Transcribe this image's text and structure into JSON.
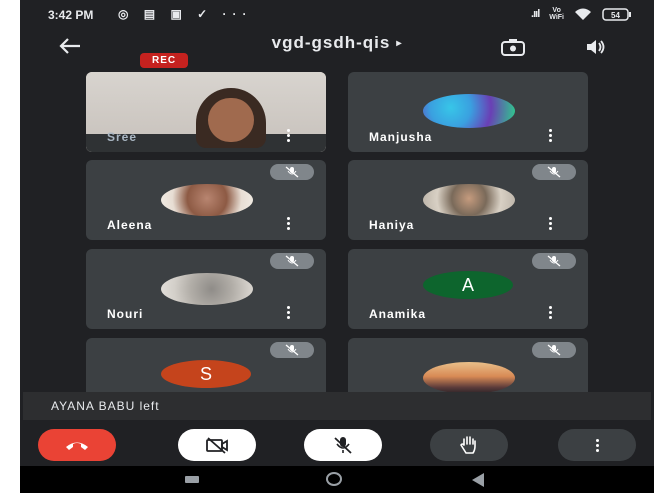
{
  "status_bar": {
    "time": "3:42 PM",
    "left_icons": "◎ ▤ ▣ ✓ ···",
    "signal": ".ııl",
    "vowifi": "Vo\nWiFi",
    "battery": "54"
  },
  "header": {
    "meeting_code": "vgd-gsdh-qis",
    "arrow": "▸",
    "rec_label": "REC"
  },
  "participants": [
    {
      "name": "Sree",
      "muted": false,
      "kind": "video"
    },
    {
      "name": "Manjusha",
      "muted": false,
      "kind": "photo"
    },
    {
      "name": "Aleena",
      "muted": true,
      "kind": "photo"
    },
    {
      "name": "Haniya",
      "muted": true,
      "kind": "photo"
    },
    {
      "name": "Nouri",
      "muted": true,
      "kind": "photo"
    },
    {
      "name": "Anamika",
      "muted": true,
      "kind": "letter",
      "letter": "A",
      "color": "#0d652d"
    },
    {
      "name": "",
      "muted": true,
      "kind": "letter",
      "letter": "S",
      "color": "#c5441c"
    },
    {
      "name": "",
      "muted": true,
      "kind": "photo"
    }
  ],
  "toast": {
    "message": "AYANA BABU left"
  },
  "controls": {
    "end_call": "end-call-icon",
    "camera": "camera-off-icon",
    "mic": "mic-off-icon",
    "raise_hand": "raise-hand-icon",
    "more": "more-options-icon"
  },
  "colors": {
    "background": "#202124",
    "tile": "#3c4043",
    "rec": "#c5221f",
    "end_call": "#ea4335",
    "anamika_avatar": "#0d652d",
    "s_avatar": "#c5441c"
  }
}
